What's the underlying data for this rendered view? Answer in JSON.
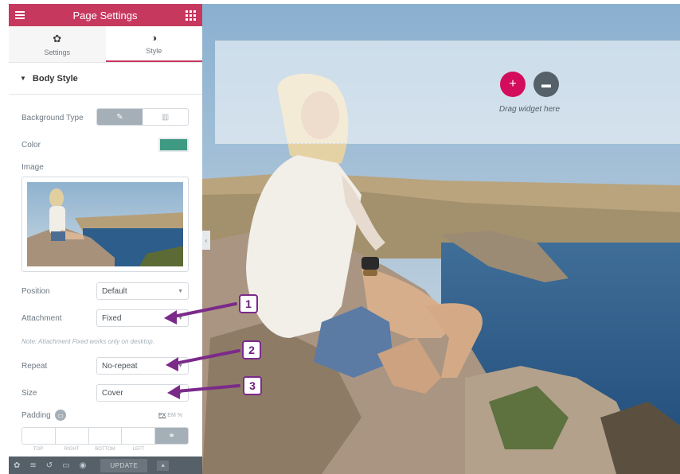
{
  "header": {
    "title": "Page Settings"
  },
  "tabs": [
    {
      "label": "Settings",
      "icon": "gear-icon",
      "active": false
    },
    {
      "label": "Style",
      "icon": "contrast-icon",
      "active": true
    }
  ],
  "section": {
    "title": "Body Style"
  },
  "controls": {
    "background_type_label": "Background Type",
    "color_label": "Color",
    "color_value": "#3f9a84",
    "image_label": "Image",
    "position_label": "Position",
    "position_value": "Default",
    "attachment_label": "Attachment",
    "attachment_value": "Fixed",
    "note": "Note: Attachment Fixed works only on desktop.",
    "repeat_label": "Repeat",
    "repeat_value": "No-repeat",
    "size_label": "Size",
    "size_value": "Cover",
    "padding_label": "Padding",
    "units": [
      "PX",
      "EM",
      "%"
    ],
    "padding_fields": [
      "TOP",
      "RIGHT",
      "BOTTOM",
      "LEFT"
    ]
  },
  "footer": {
    "update_label": "UPDATE"
  },
  "canvas": {
    "drop_text": "Drag widget here"
  },
  "callouts": [
    "1",
    "2",
    "3"
  ],
  "colors": {
    "brand": "#c7385f",
    "accent": "#d30c5c",
    "annotation": "#7b2a8a"
  }
}
